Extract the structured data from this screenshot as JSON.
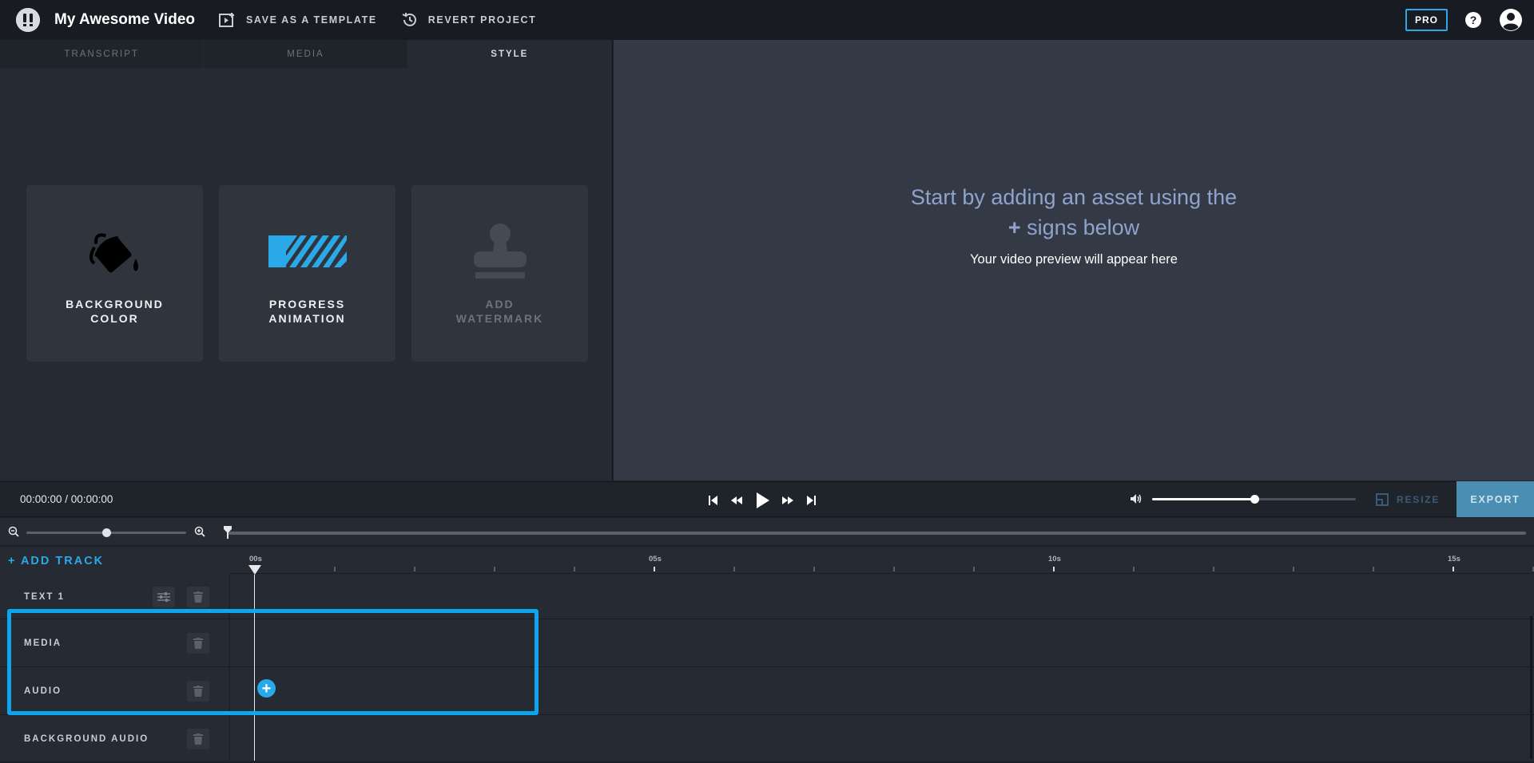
{
  "app": {
    "title": "My Awesome Video",
    "save_template_label": "SAVE AS A TEMPLATE",
    "revert_label": "REVERT PROJECT",
    "pro_label": "PRO",
    "help_glyph": "?"
  },
  "tabs": [
    {
      "label": "TRANSCRIPT",
      "active": false
    },
    {
      "label": "MEDIA",
      "active": false
    },
    {
      "label": "STYLE",
      "active": true
    }
  ],
  "style_cards": [
    {
      "label": "BACKGROUND COLOR",
      "icon": "paint-bucket-icon",
      "enabled": true
    },
    {
      "label": "PROGRESS ANIMATION",
      "icon": "progress-stripes-icon",
      "enabled": true
    },
    {
      "label": "ADD WATERMARK",
      "icon": "stamp-icon",
      "enabled": false
    }
  ],
  "preview": {
    "line1": "Start by adding an asset using the",
    "plus": "+",
    "line2": " signs below",
    "sub": "Your video preview will appear here"
  },
  "controls": {
    "timecode": "00:00:00 / 00:00:00",
    "volume_level": 0.5,
    "resize_label": "RESIZE",
    "export_label": "EXPORT"
  },
  "zoom": {
    "level": 0.5
  },
  "timeline": {
    "add_track_label": "+ ADD TRACK",
    "ruler_labels": [
      "00s",
      "05s",
      "10s",
      "15s"
    ],
    "tracks": [
      {
        "name": "TEXT 1",
        "has_settings": true
      },
      {
        "name": "MEDIA",
        "has_settings": false
      },
      {
        "name": "AUDIO",
        "has_settings": false
      },
      {
        "name": "BACKGROUND AUDIO",
        "has_settings": false
      }
    ],
    "add_media_glyph": "+"
  },
  "colors": {
    "accent": "#29a9e8",
    "highlight": "#0ea5f0",
    "export": "#4a8eb3",
    "preview_bg": "#343946"
  }
}
